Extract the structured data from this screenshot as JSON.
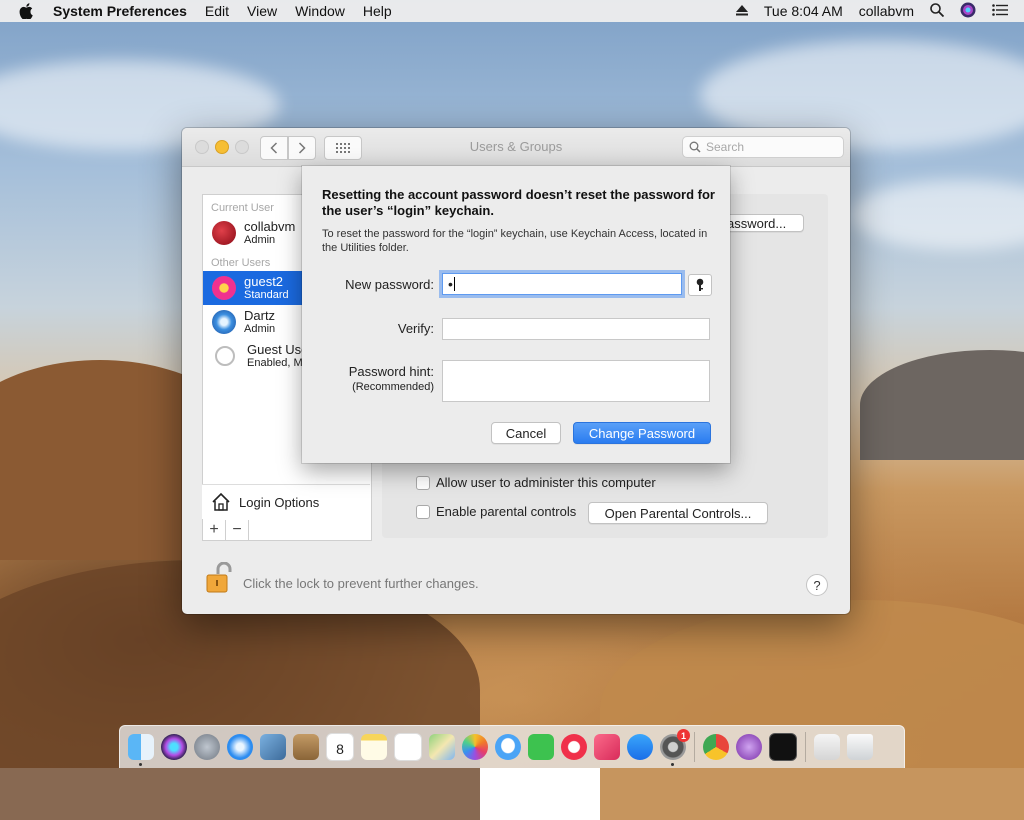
{
  "menubar": {
    "app_name": "System Preferences",
    "menus": [
      "Edit",
      "View",
      "Window",
      "Help"
    ],
    "clock": "Tue 8:04 AM",
    "user": "collabvm"
  },
  "window": {
    "title": "Users & Groups",
    "search_placeholder": "Search"
  },
  "sidebar": {
    "current_user_header": "Current User",
    "other_users_header": "Other Users",
    "users": [
      {
        "name": "collabvm",
        "role": "Admin"
      },
      {
        "name": "guest2",
        "role": "Standard"
      },
      {
        "name": "Dartz",
        "role": "Admin"
      },
      {
        "name": "Guest Use",
        "role": "Enabled, M"
      }
    ],
    "login_options": "Login Options",
    "add_symbol": "+",
    "remove_symbol": "−"
  },
  "panel": {
    "change_password_partial": "assword...",
    "allow_admin_label": "Allow user to administer this computer",
    "parental_label": "Enable parental controls",
    "open_parental_button": "Open Parental Controls..."
  },
  "footer": {
    "lock_text": "Click the lock to prevent further changes.",
    "help_symbol": "?"
  },
  "sheet": {
    "headline": "Resetting the account password doesn’t reset the password for the user’s “login” keychain.",
    "subtext": "To reset the password for the “login” keychain, use Keychain Access, located in the Utilities folder.",
    "new_password_label": "New password:",
    "new_password_value": "•",
    "verify_label": "Verify:",
    "hint_label": "Password hint:",
    "hint_sublabel": "(Recommended)",
    "cancel_button": "Cancel",
    "change_button": "Change Password"
  },
  "dock": {
    "items": [
      "finder-icon",
      "siri-icon",
      "launchpad-icon",
      "safari-icon",
      "preview-icon",
      "contacts-icon",
      "calendar-icon",
      "notes-icon",
      "reminders-icon",
      "maps-icon",
      "photos-icon",
      "messages-icon",
      "facetime-icon",
      "news-icon",
      "music-icon",
      "appstore-icon",
      "system-preferences-icon",
      "chrome-icon",
      "tor-browser-icon",
      "terminal-icon",
      "downloads-icon",
      "trash-icon"
    ],
    "calendar_day": "8",
    "sysprefs_badge": "1"
  }
}
